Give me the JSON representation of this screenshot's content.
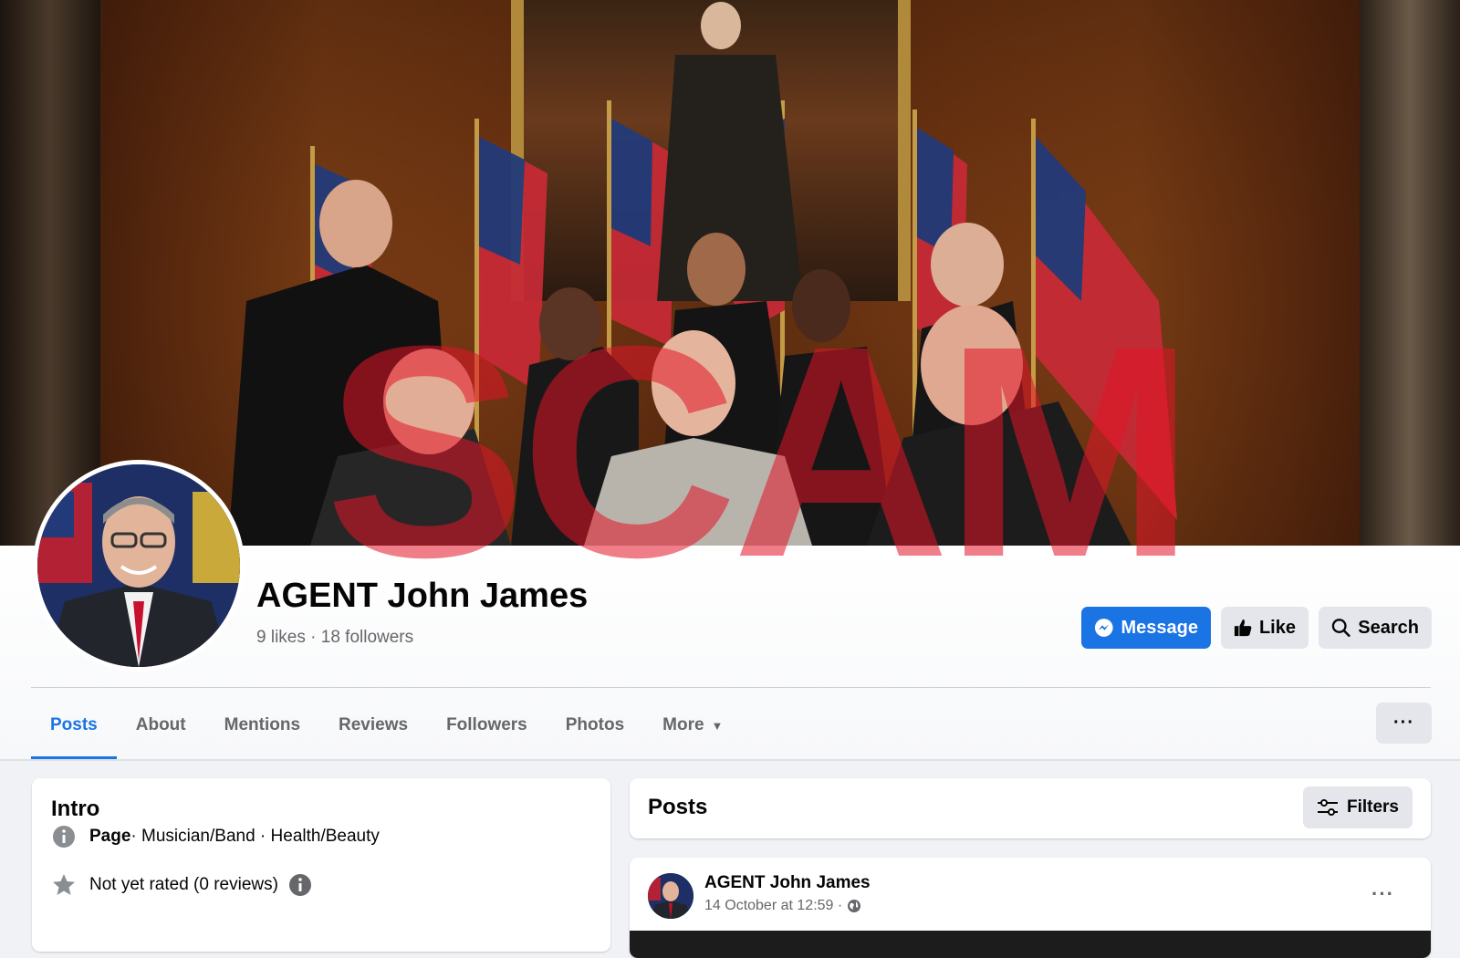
{
  "watermark": {
    "text": "SCAM",
    "color": "#e11428"
  },
  "page": {
    "name": "AGENT John James",
    "likes": "9 likes",
    "separator": "·",
    "followers": "18 followers"
  },
  "actions": {
    "message_label": "Message",
    "like_label": "Like",
    "search_label": "Search",
    "primary_color": "#1b74e4"
  },
  "tabs": [
    {
      "label": "Posts",
      "active": true
    },
    {
      "label": "About"
    },
    {
      "label": "Mentions"
    },
    {
      "label": "Reviews"
    },
    {
      "label": "Followers"
    },
    {
      "label": "Photos"
    },
    {
      "label": "More"
    }
  ],
  "tab_options_label": "···",
  "intro": {
    "title": "Intro",
    "category_bold": "Page",
    "category_rest": " · Musician/Band · Health/Beauty",
    "rating": "Not yet rated (0 reviews)"
  },
  "posts": {
    "title": "Posts",
    "filters_label": "Filters"
  },
  "post": {
    "author": "AGENT John James",
    "date": "14 October at 12:59 ·",
    "options_label": "···"
  },
  "icons": {
    "message": "messenger-icon",
    "like": "thumbs-up-icon",
    "search": "search-icon",
    "info": "info-icon",
    "star": "star-icon",
    "filters": "sliders-icon",
    "audience": "globe-icon"
  }
}
